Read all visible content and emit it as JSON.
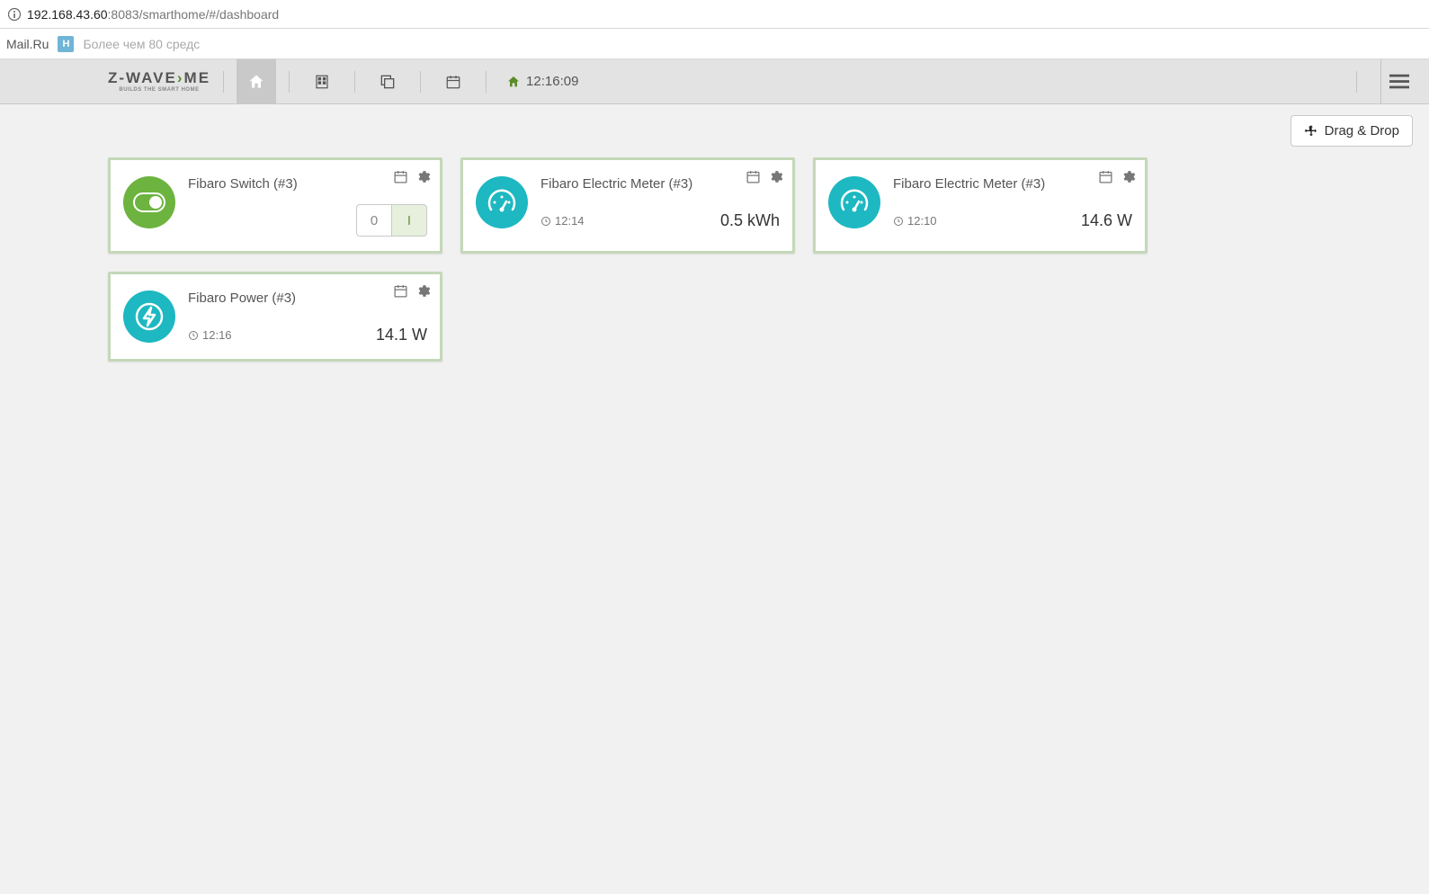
{
  "browser": {
    "url_host": "192.168.43.60",
    "url_rest": ":8083/smarthome/#/dashboard",
    "bookmarks": {
      "mailru": "Mail.Ru",
      "h_badge": "H",
      "truncated": "Более чем 80 средс"
    }
  },
  "navbar": {
    "logo_main_a": "Z-WAVE",
    "logo_main_b": "ME",
    "logo_chevron": "›",
    "logo_sub": "BUILDS THE SMART HOME",
    "clock": "12:16:09"
  },
  "drag_button": "Drag & Drop",
  "cards": [
    {
      "type": "switch",
      "title": "Fibaro Switch (#3)",
      "off_label": "0",
      "on_label": "I"
    },
    {
      "type": "meter",
      "title": "Fibaro Electric Meter (#3)",
      "time": "12:14",
      "value": "0.5 kWh"
    },
    {
      "type": "meter",
      "title": "Fibaro Electric Meter (#3)",
      "time": "12:10",
      "value": "14.6 W"
    },
    {
      "type": "power",
      "title": "Fibaro Power (#3)",
      "time": "12:16",
      "value": "14.1 W"
    }
  ]
}
